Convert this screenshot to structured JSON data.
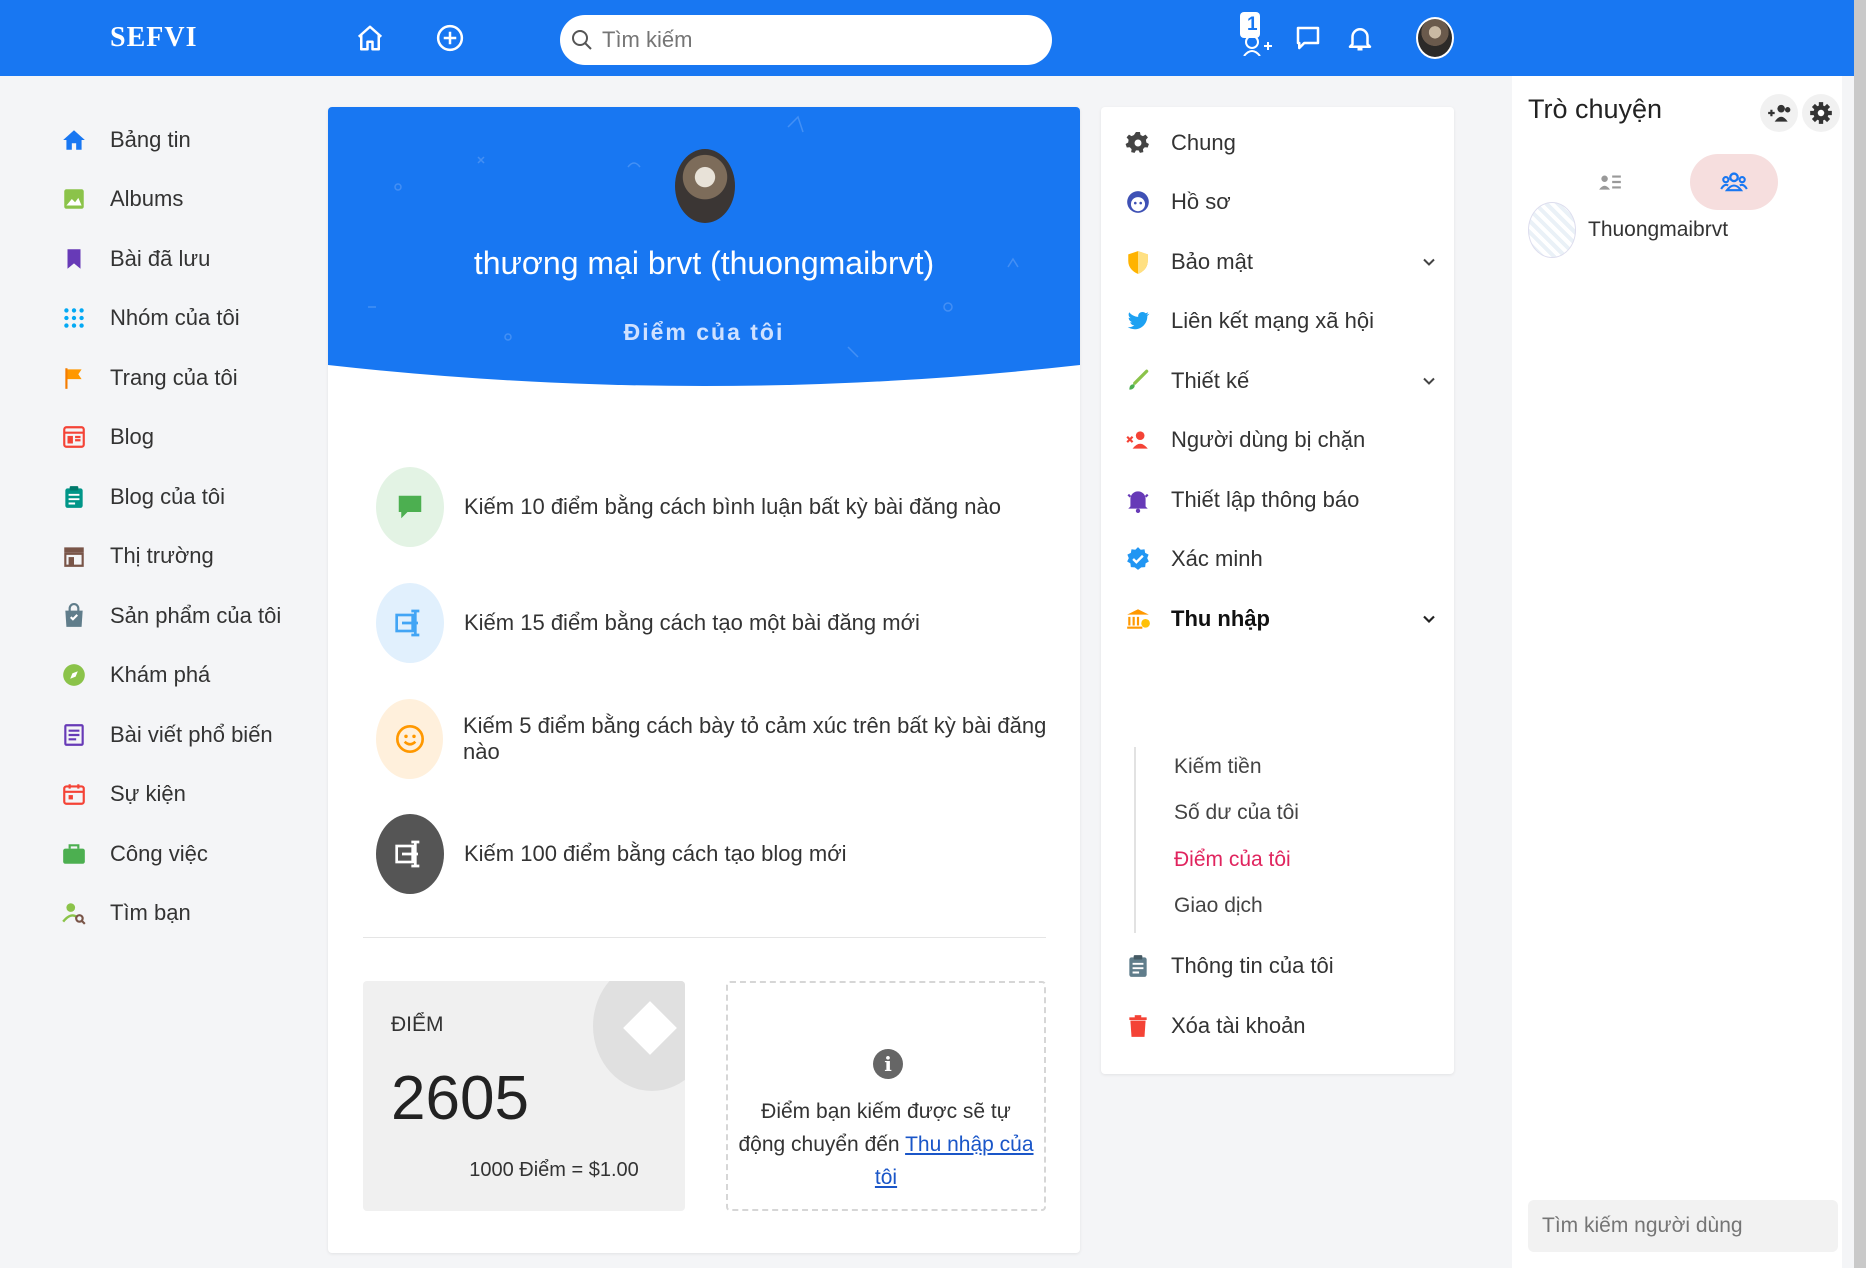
{
  "app": {
    "logo": "SEFVI"
  },
  "search": {
    "placeholder": "Tìm kiếm"
  },
  "topbar": {
    "friend_requests_count": "1"
  },
  "sidebar": {
    "items": [
      {
        "label": "Bảng tin",
        "icon": "home-icon"
      },
      {
        "label": "Albums",
        "icon": "image-icon"
      },
      {
        "label": "Bài đã lưu",
        "icon": "bookmark-icon"
      },
      {
        "label": "Nhóm của tôi",
        "icon": "group-grid-icon"
      },
      {
        "label": "Trang của tôi",
        "icon": "flag-icon"
      },
      {
        "label": "Blog",
        "icon": "blog-icon"
      },
      {
        "label": "Blog của tôi",
        "icon": "clipboard-icon"
      },
      {
        "label": "Thị trường",
        "icon": "store-icon"
      },
      {
        "label": "Sản phẩm của tôi",
        "icon": "shopping-bag-icon"
      },
      {
        "label": "Khám phá",
        "icon": "compass-icon"
      },
      {
        "label": "Bài viết phổ biến",
        "icon": "article-icon"
      },
      {
        "label": "Sự kiện",
        "icon": "calendar-icon"
      },
      {
        "label": "Công việc",
        "icon": "briefcase-icon"
      },
      {
        "label": "Tìm bạn",
        "icon": "find-friend-icon"
      }
    ]
  },
  "profile": {
    "name": "thương mại brvt (thuongmaibrvt)",
    "subtitle": "Điểm của tôi"
  },
  "earn": [
    {
      "text": "Kiếm 10 điểm bằng cách bình luận bất kỳ bài đăng nào",
      "icon": "comment-icon",
      "color": "#4caf50"
    },
    {
      "text": "Kiếm 15 điểm bằng cách tạo một bài đăng mới",
      "icon": "post-icon",
      "color": "#42a5f5"
    },
    {
      "text": "Kiếm 5 điểm bằng cách bày tỏ cảm xúc trên bất kỳ bài đăng nào",
      "icon": "smile-icon",
      "color": "#ff9800"
    },
    {
      "text": "Kiếm 100 điểm bằng cách tạo blog mới",
      "icon": "blog-post-icon",
      "color": "#555555"
    }
  ],
  "points": {
    "label": "ĐIỂM",
    "value": "2605",
    "rate": "1000 Điểm = $1.00"
  },
  "info": {
    "text": "Điểm bạn kiếm được sẽ tự động chuyển đến",
    "link": "Thu nhập của tôi"
  },
  "settings": {
    "items": [
      {
        "label": "Chung",
        "icon": "gear-icon"
      },
      {
        "label": "Hồ sơ",
        "icon": "profile-face-icon"
      },
      {
        "label": "Bảo mật",
        "icon": "shield-icon"
      },
      {
        "label": "Liên kết mạng xã hội",
        "icon": "twitter-icon"
      },
      {
        "label": "Thiết kế",
        "icon": "brush-icon"
      },
      {
        "label": "Người dùng bị chặn",
        "icon": "blocked-user-icon"
      },
      {
        "label": "Thiết lập thông báo",
        "icon": "bell-icon"
      },
      {
        "label": "Xác minh",
        "icon": "verified-icon"
      },
      {
        "label": "Thu nhập",
        "icon": "bank-icon"
      },
      {
        "label": "Thông tin của tôi",
        "icon": "clipboard-icon"
      },
      {
        "label": "Xóa tài khoản",
        "icon": "trash-icon"
      }
    ],
    "earnings_sub": [
      "Kiếm tiền",
      "Số dư của tôi",
      "Điểm của tôi",
      "Giao dịch"
    ]
  },
  "chat": {
    "title": "Trò chuyện",
    "user": "Thuongmaibrvt",
    "search_placeholder": "Tìm kiếm người dùng"
  },
  "colors": {
    "brand": "#1877f2",
    "selected_sub": "#e0245e"
  }
}
